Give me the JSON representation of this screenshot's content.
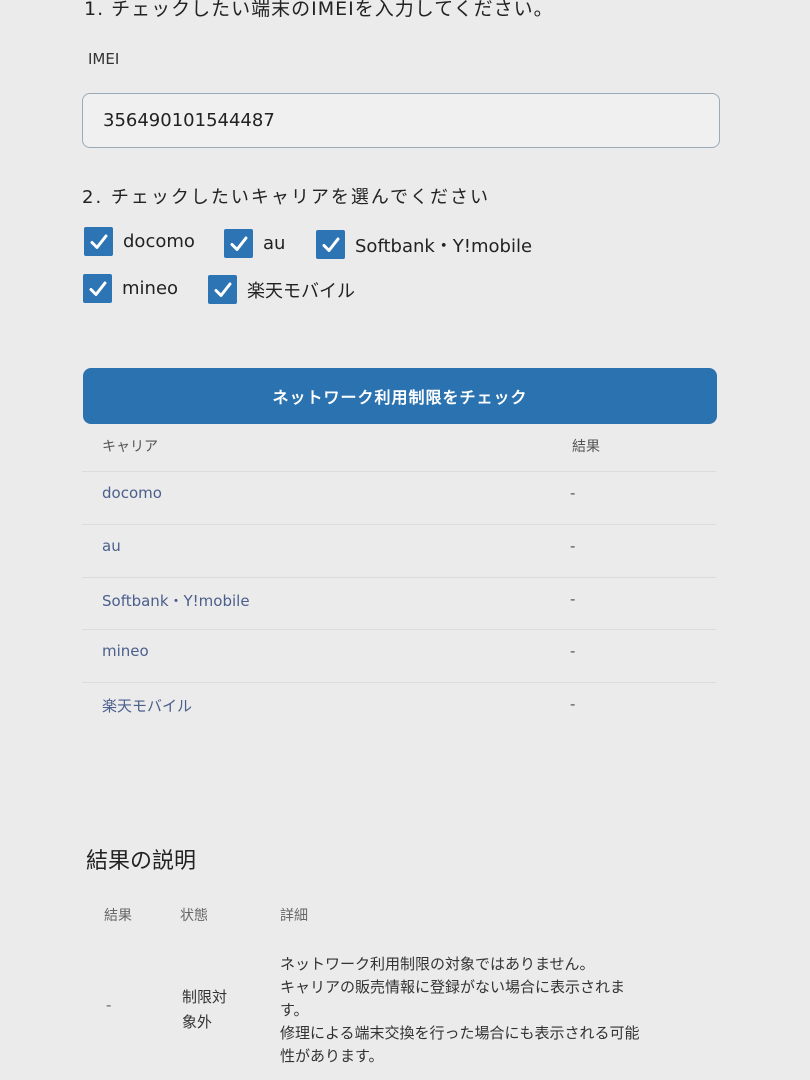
{
  "form": {
    "step1_text": "1. チェックしたい端末のIMEIを入力してください。",
    "imei_label": "IMEI",
    "imei_value": "356490101544487",
    "step2_text": "2. チェックしたいキャリアを選んでください",
    "carriers": [
      {
        "label": "docomo",
        "checked": true
      },
      {
        "label": "au",
        "checked": true
      },
      {
        "label": "Softbank・Y!mobile",
        "checked": true
      },
      {
        "label": "mineo",
        "checked": true
      },
      {
        "label": "楽天モバイル",
        "checked": true
      }
    ],
    "check_button": "ネットワーク利用制限をチェック"
  },
  "results": {
    "header_carrier": "キャリア",
    "header_result": "結果",
    "rows": [
      {
        "carrier": "docomo",
        "result": "-"
      },
      {
        "carrier": "au",
        "result": "-"
      },
      {
        "carrier": "Softbank・Y!mobile",
        "result": "-"
      },
      {
        "carrier": "mineo",
        "result": "-"
      },
      {
        "carrier": "楽天モバイル",
        "result": "-"
      }
    ]
  },
  "explanation": {
    "title": "結果の説明",
    "header_result": "結果",
    "header_status": "状態",
    "header_detail": "詳細",
    "row_result": "-",
    "row_status_1": "制限対",
    "row_status_2": "象外",
    "detail_lines": [
      "ネットワーク利用制限の対象ではありません。",
      "キャリアの販売情報に登録がない場合に表示されま",
      "す。",
      "修理による端末交換を行った場合にも表示される可能",
      "性があります。"
    ]
  },
  "colors": {
    "accent": "#2c74b4",
    "button": "#2b72b0",
    "link_text": "#4b5f8c"
  }
}
